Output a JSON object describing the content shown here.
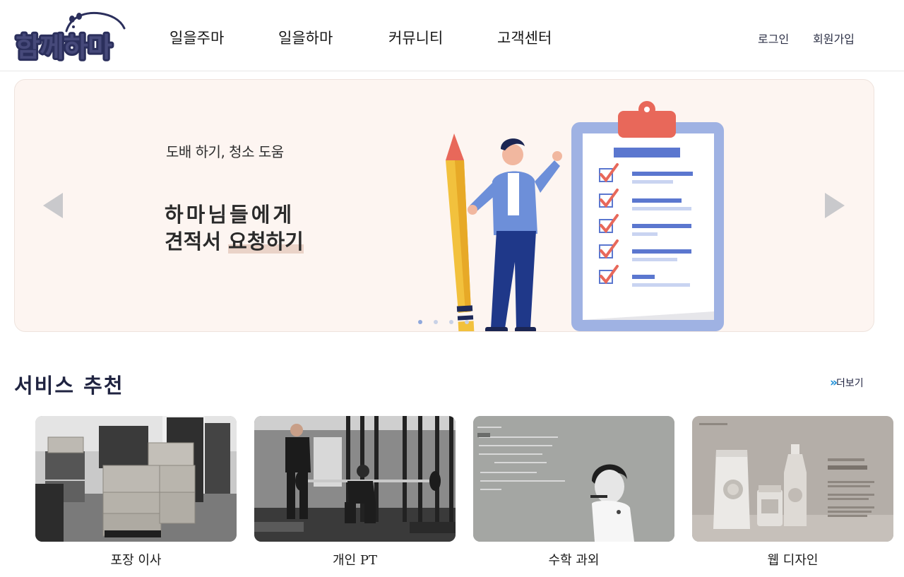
{
  "header": {
    "logo_text": "함께하마",
    "nav": [
      "일을주마",
      "일을하마",
      "커뮤니티",
      "고객센터"
    ],
    "login_label": "로그인",
    "signup_label": "회원가입"
  },
  "banner": {
    "subtitle": "도배 하기, 청소 도움",
    "title_line1": "하마님들에게",
    "title_line2_plain": "견적서 ",
    "title_line2_highlight": "요청하기",
    "slide_count": 4,
    "active_slide": 1,
    "background_color": "#fdf5f1",
    "accent_color": "#e8685a"
  },
  "section": {
    "title": "서비스 추천",
    "more_label": "더보기",
    "more_icon": "double-chevron-right-icon"
  },
  "services": [
    {
      "label": "포장 이사"
    },
    {
      "label": "개인 PT"
    },
    {
      "label": "수학 과외"
    },
    {
      "label": "웹 디자인"
    }
  ],
  "colors": {
    "brand_navy": "#2b2f5c",
    "link_blue": "#1e90d8",
    "dot_active": "#8fa8dc",
    "dot_inactive": "#c8d1e6"
  }
}
